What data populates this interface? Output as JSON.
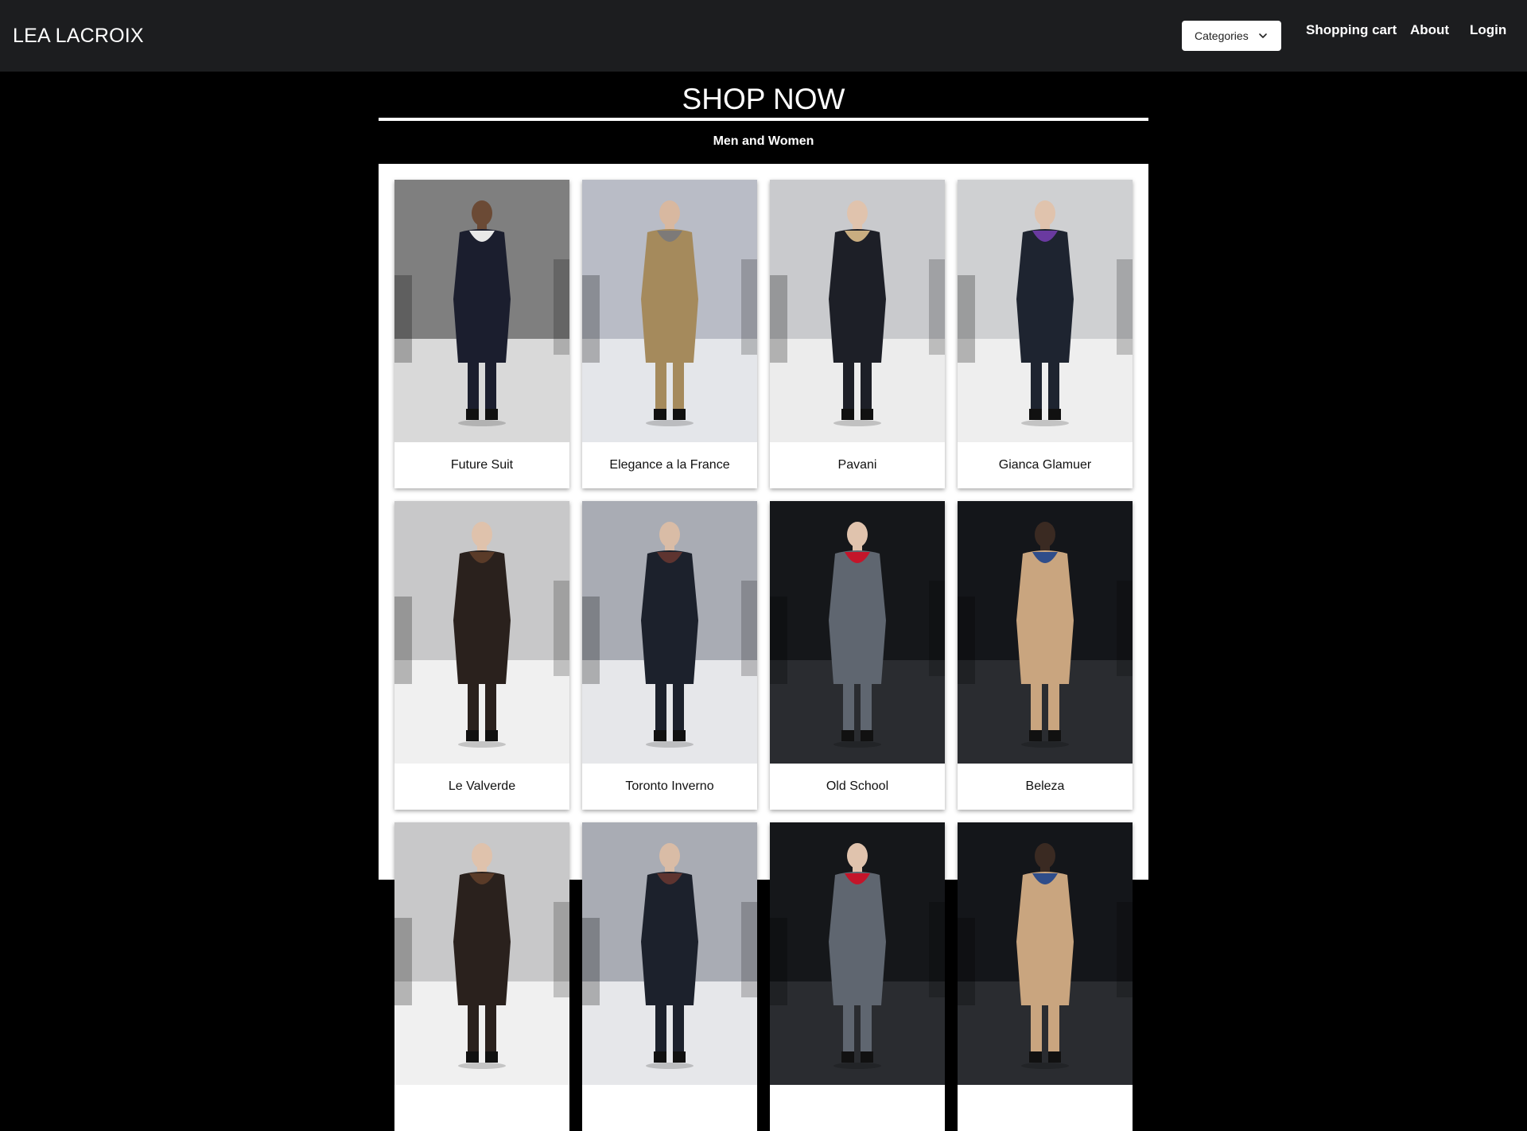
{
  "nav": {
    "brand": "LEA LACROIX",
    "categories_label": "Categories",
    "cart_label": "Shopping cart",
    "about_label": "About",
    "login_label": "Login"
  },
  "hero": {
    "title": "SHOP NOW",
    "subtitle": "Men and Women"
  },
  "products": [
    {
      "name": "Future Suit",
      "bg": "#7f7f7f",
      "floor": "#d9d9d9",
      "coat": "#1b1e2e",
      "accent": "#e8e8e8",
      "skin": "#6b4a35"
    },
    {
      "name": "Elegance a la France",
      "bg": "#b9bcc6",
      "floor": "#e4e6ea",
      "coat": "#a58a5c",
      "accent": "#7d7a78",
      "skin": "#d8b8a0"
    },
    {
      "name": "Pavani",
      "bg": "#c9cacd",
      "floor": "#ececec",
      "coat": "#1d1f27",
      "accent": "#c9ad80",
      "skin": "#e0c3ad"
    },
    {
      "name": "Gianca Glamuer",
      "bg": "#cfd0d2",
      "floor": "#eeeeee",
      "coat": "#1e2430",
      "accent": "#6a3aa0",
      "skin": "#e0c3ad"
    },
    {
      "name": "Le Valverde",
      "bg": "#c8c8c9",
      "floor": "#f0f0f0",
      "coat": "#2a211d",
      "accent": "#5a3b28",
      "skin": "#dfc2ac"
    },
    {
      "name": "Toronto Inverno",
      "bg": "#a9acb4",
      "floor": "#e6e7ea",
      "coat": "#1c212c",
      "accent": "#5e3430",
      "skin": "#d9bca6"
    },
    {
      "name": "Old School",
      "bg": "#15171a",
      "floor": "#2a2c30",
      "coat": "#5f6670",
      "accent": "#c4152a",
      "skin": "#e0c3ad"
    },
    {
      "name": "Beleza",
      "bg": "#14161a",
      "floor": "#2a2c30",
      "coat": "#c9a57f",
      "accent": "#2f4d8a",
      "skin": "#3a2a22"
    },
    {
      "name": "",
      "bg": "#c8c8c9",
      "floor": "#f0f0f0",
      "coat": "#2a211d",
      "accent": "#5a3b28",
      "skin": "#dfc2ac"
    },
    {
      "name": "",
      "bg": "#a9acb4",
      "floor": "#e6e7ea",
      "coat": "#1c212c",
      "accent": "#5e3430",
      "skin": "#d9bca6"
    },
    {
      "name": "",
      "bg": "#15171a",
      "floor": "#2a2c30",
      "coat": "#5f6670",
      "accent": "#c4152a",
      "skin": "#e0c3ad"
    },
    {
      "name": "",
      "bg": "#14161a",
      "floor": "#2a2c30",
      "coat": "#c9a57f",
      "accent": "#2f4d8a",
      "skin": "#3a2a22"
    }
  ],
  "colors": {
    "navbar_bg": "#1c1d1f",
    "page_bg": "#000000",
    "panel_bg": "#ffffff"
  },
  "icons": {
    "categories_caret": "chevron-down-icon"
  }
}
